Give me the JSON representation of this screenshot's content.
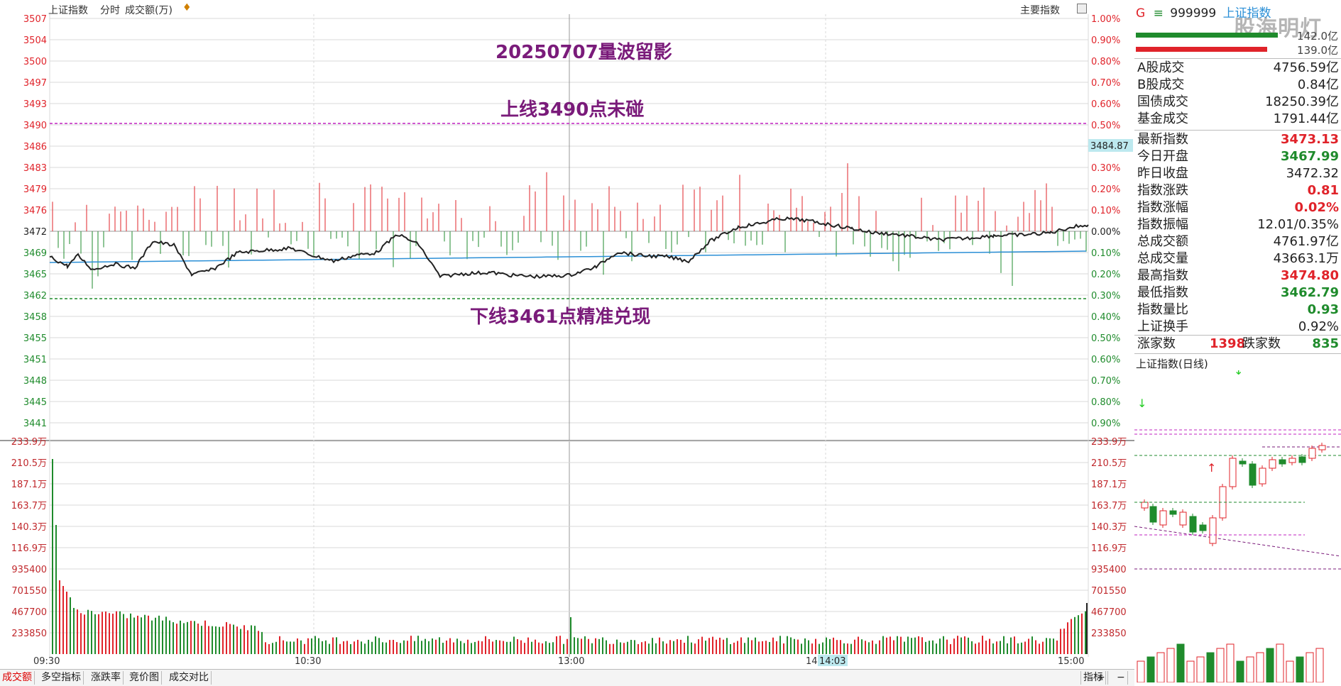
{
  "header": {
    "index_name": "上证指数",
    "mode": "分时",
    "indicator": "成交额(万)",
    "main_indicator_label": "主要指数"
  },
  "annotations": {
    "title": "20250707量波留影",
    "upper": "上线3490点未碰",
    "lower": "下线3461点精准兑现"
  },
  "price_axis": {
    "left": [
      "3507",
      "3504",
      "3500",
      "3497",
      "3493",
      "3490",
      "3486",
      "3483",
      "3479",
      "3476",
      "3472",
      "3469",
      "3465",
      "3462",
      "3458",
      "3455",
      "3451",
      "3448",
      "3445",
      "3441"
    ],
    "right": [
      "1.00%",
      "0.90%",
      "0.80%",
      "0.70%",
      "0.60%",
      "0.50%",
      "0.40%",
      "0.30%",
      "0.20%",
      "0.10%",
      "0.00%",
      "0.10%",
      "0.20%",
      "0.30%",
      "0.40%",
      "0.50%",
      "0.60%",
      "0.70%",
      "0.80%",
      "0.90%"
    ],
    "current_tag": "3484.87"
  },
  "volume_axis": {
    "labels": [
      "233.9万",
      "210.5万",
      "187.1万",
      "163.7万",
      "140.3万",
      "116.9万",
      "935400",
      "701550",
      "467700",
      "233850"
    ]
  },
  "time_axis": {
    "labels": [
      "09:30",
      "10:30",
      "13:00",
      "14",
      "15:00"
    ],
    "cursor": "14:03"
  },
  "bottom_tabs": [
    "成交额",
    "多空指标",
    "涨跌率",
    "竞价图",
    "成交对比"
  ],
  "bottom_right": [
    "指标",
    "+",
    "−"
  ],
  "panel": {
    "code_prefix": "G",
    "code": "999999",
    "name": "上证指数",
    "watermark": "股海明灯",
    "bar_val1": "142.0亿",
    "bar_val2": "139.0亿",
    "rows_a": [
      {
        "label": "A股成交",
        "value": "4756.59亿",
        "color": "black"
      },
      {
        "label": "B股成交",
        "value": "0.84亿",
        "color": "black"
      },
      {
        "label": "国债成交",
        "value": "18250.39亿",
        "color": "black"
      },
      {
        "label": "基金成交",
        "value": "1791.44亿",
        "color": "black"
      }
    ],
    "rows_b": [
      {
        "label": "最新指数",
        "value": "3473.13",
        "color": "red"
      },
      {
        "label": "今日开盘",
        "value": "3467.99",
        "color": "green"
      },
      {
        "label": "昨日收盘",
        "value": "3472.32",
        "color": "black"
      },
      {
        "label": "指数涨跌",
        "value": "0.81",
        "color": "red"
      },
      {
        "label": "指数涨幅",
        "value": "0.02%",
        "color": "red"
      },
      {
        "label": "指数振幅",
        "value": "12.01/0.35%",
        "color": "black"
      },
      {
        "label": "总成交额",
        "value": "4761.97亿",
        "color": "black"
      },
      {
        "label": "总成交量",
        "value": "43663.1万",
        "color": "black"
      },
      {
        "label": "最高指数",
        "value": "3474.80",
        "color": "red"
      },
      {
        "label": "最低指数",
        "value": "3462.79",
        "color": "green"
      },
      {
        "label": "指数量比",
        "value": "0.93",
        "color": "green"
      },
      {
        "label": "上证换手",
        "value": "0.92%",
        "color": "black"
      }
    ],
    "up_label": "涨家数",
    "up_count": "1398",
    "down_label": "跌家数",
    "down_count": "835",
    "mini_title": "上证指数(日线)"
  },
  "colors": {
    "up": "#e0232a",
    "down": "#1f8b2c",
    "avg_line": "#2b8fd6",
    "price_line": "#222222",
    "annotation": "#7a1b7a",
    "upper_line": "#c020c0",
    "lower_line": "#1f8b2c"
  }
}
